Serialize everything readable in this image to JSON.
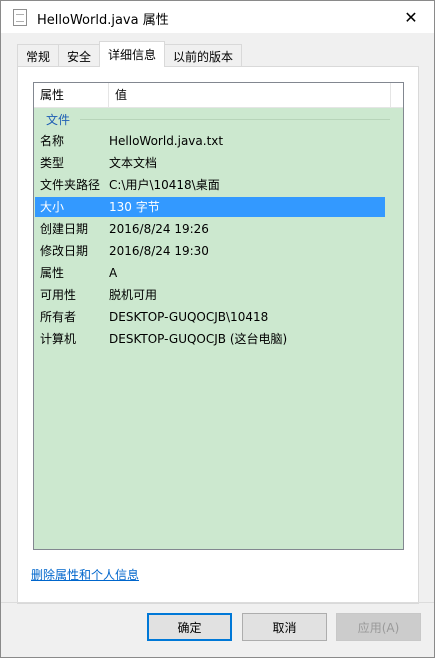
{
  "window": {
    "title": "HelloWorld.java 属性",
    "close_glyph": "✕"
  },
  "tabs": [
    {
      "label": "常规"
    },
    {
      "label": "安全"
    },
    {
      "label": "详细信息"
    },
    {
      "label": "以前的版本"
    }
  ],
  "details": {
    "columns": {
      "property": "属性",
      "value": "值"
    },
    "group": "文件",
    "rows": [
      {
        "key": "名称",
        "value": "HelloWorld.java.txt"
      },
      {
        "key": "类型",
        "value": "文本文档"
      },
      {
        "key": "文件夹路径",
        "value": "C:\\用户\\10418\\桌面"
      },
      {
        "key": "大小",
        "value": "130 字节"
      },
      {
        "key": "创建日期",
        "value": "2016/8/24 19:26"
      },
      {
        "key": "修改日期",
        "value": "2016/8/24 19:30"
      },
      {
        "key": "属性",
        "value": "A"
      },
      {
        "key": "可用性",
        "value": "脱机可用"
      },
      {
        "key": "所有者",
        "value": "DESKTOP-GUQOCJB\\10418"
      },
      {
        "key": "计算机",
        "value": "DESKTOP-GUQOCJB (这台电脑)"
      }
    ],
    "selected_row": "大小"
  },
  "remove_link": "删除属性和个人信息",
  "buttons": {
    "ok": "确定",
    "cancel": "取消",
    "apply": "应用(A)"
  },
  "colors": {
    "list_background": "#cce8cf",
    "selection": "#3399ff",
    "link": "#0066cc"
  }
}
